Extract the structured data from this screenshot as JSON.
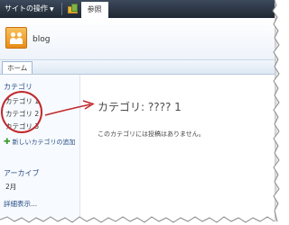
{
  "ribbon": {
    "site_actions": "サイトの操作",
    "browse_tab": "参照"
  },
  "header": {
    "site_title": "blog"
  },
  "topnav": {
    "home": "ホーム"
  },
  "leftnav": {
    "categories_heading": "カテゴリ",
    "categories": [
      "カテゴリ 1",
      "カテゴリ 2",
      "カテゴリ 3"
    ],
    "add_category": "新しいカテゴリの追加",
    "archive_heading": "アーカイブ",
    "archive_items": [
      "2月"
    ],
    "more_link": "詳細表示..."
  },
  "main": {
    "title": "カテゴリ: ???? 1",
    "empty_message": "このカテゴリには投稿はありません。"
  },
  "colors": {
    "annotation": "#c0282b",
    "link": "#2a4f86"
  }
}
